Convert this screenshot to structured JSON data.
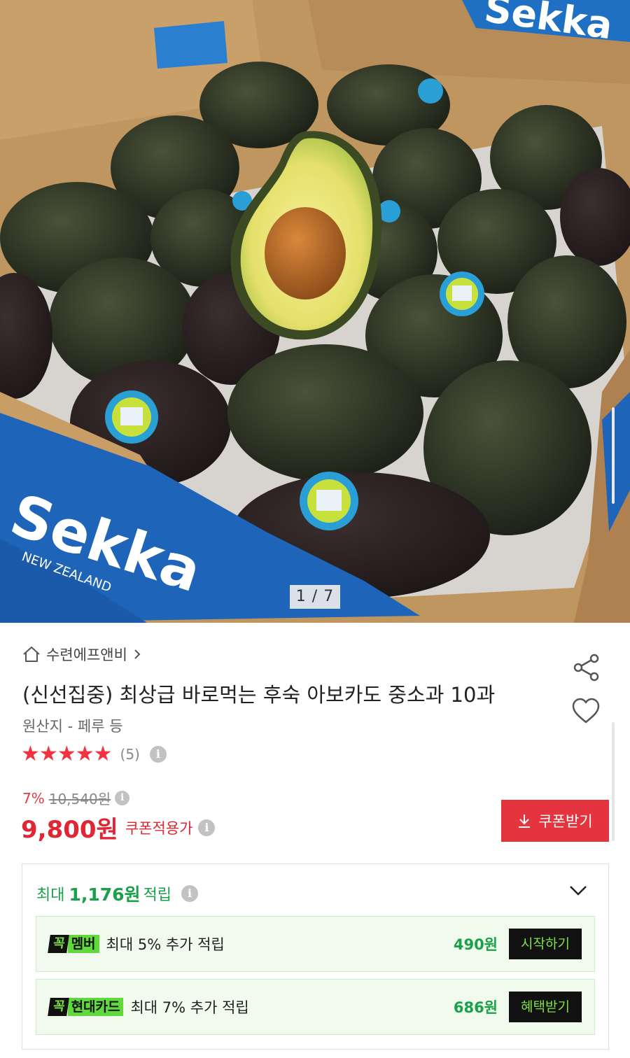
{
  "gallery": {
    "counter": "1 / 7",
    "brand_text": "Sekka",
    "brand_sub": "NEW ZEALAND"
  },
  "store": {
    "name": "수련에프앤비",
    "icon": "home-icon"
  },
  "product": {
    "title": "(신선집중) 최상급 바로먹는 후숙 아보카도 중소과 10과",
    "origin": "원산지 - 페루 등",
    "rating": 5,
    "review_count": "(5)",
    "discount_pct": "7%",
    "original_price": "10,540원",
    "sale_price": "9,800원",
    "sale_label": "쿠폰적용가"
  },
  "actions": {
    "coupon_button": "쿠폰받기"
  },
  "points": {
    "prefix": "최대",
    "amount": "1,176원",
    "suffix": "적립",
    "rows": [
      {
        "badge_k": "꼭",
        "badge_name": "멤버",
        "desc": "최대 5% 추가 적립",
        "amount": "490원",
        "action": "시작하기"
      },
      {
        "badge_k": "꼭",
        "badge_name": "현대카드",
        "desc": "최대 7% 추가 적립",
        "amount": "686원",
        "action": "혜택받기"
      }
    ]
  },
  "colors": {
    "accent_red": "#e4353f",
    "accent_green": "#1aa04a",
    "badge_green": "#60d93a"
  }
}
